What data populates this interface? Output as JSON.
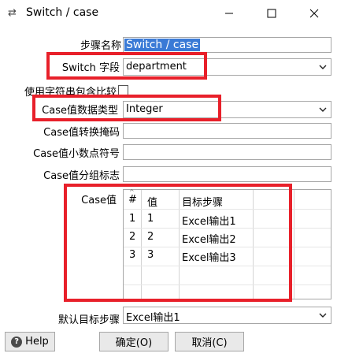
{
  "window": {
    "title": "Switch / case",
    "app_icon": "switch-arrows-icon",
    "controls": [
      "minimize-icon",
      "maximize-icon",
      "close-icon"
    ]
  },
  "form": {
    "step_name_label": "步骤名称",
    "step_name_value": "Switch / case",
    "switch_field_label": "Switch 字段",
    "switch_field_value": "department",
    "use_string_contains_label": "使用字符串包含比较",
    "use_string_contains_checked": false,
    "case_type_label": "Case值数据类型",
    "case_type_value": "Integer",
    "case_mask_label": "Case值转换掩码",
    "case_mask_value": "",
    "case_decimal_label": "Case值小数点符号",
    "case_decimal_value": "",
    "case_group_label": "Case值分组标志",
    "case_group_value": "",
    "case_values_label": "Case值",
    "default_target_label": "默认目标步骤",
    "default_target_value": "Excel输出1"
  },
  "table": {
    "headers": [
      "#",
      "值",
      "目标步骤"
    ],
    "rows": [
      [
        "1",
        "1",
        "Excel输出1"
      ],
      [
        "2",
        "2",
        "Excel输出2"
      ],
      [
        "3",
        "3",
        "Excel输出3"
      ]
    ]
  },
  "buttons": {
    "help": "Help",
    "ok": "确定(O)",
    "cancel": "取消(C)"
  },
  "colors": {
    "annotation_box": "#e8202a",
    "selection": "#3a7ad6"
  }
}
